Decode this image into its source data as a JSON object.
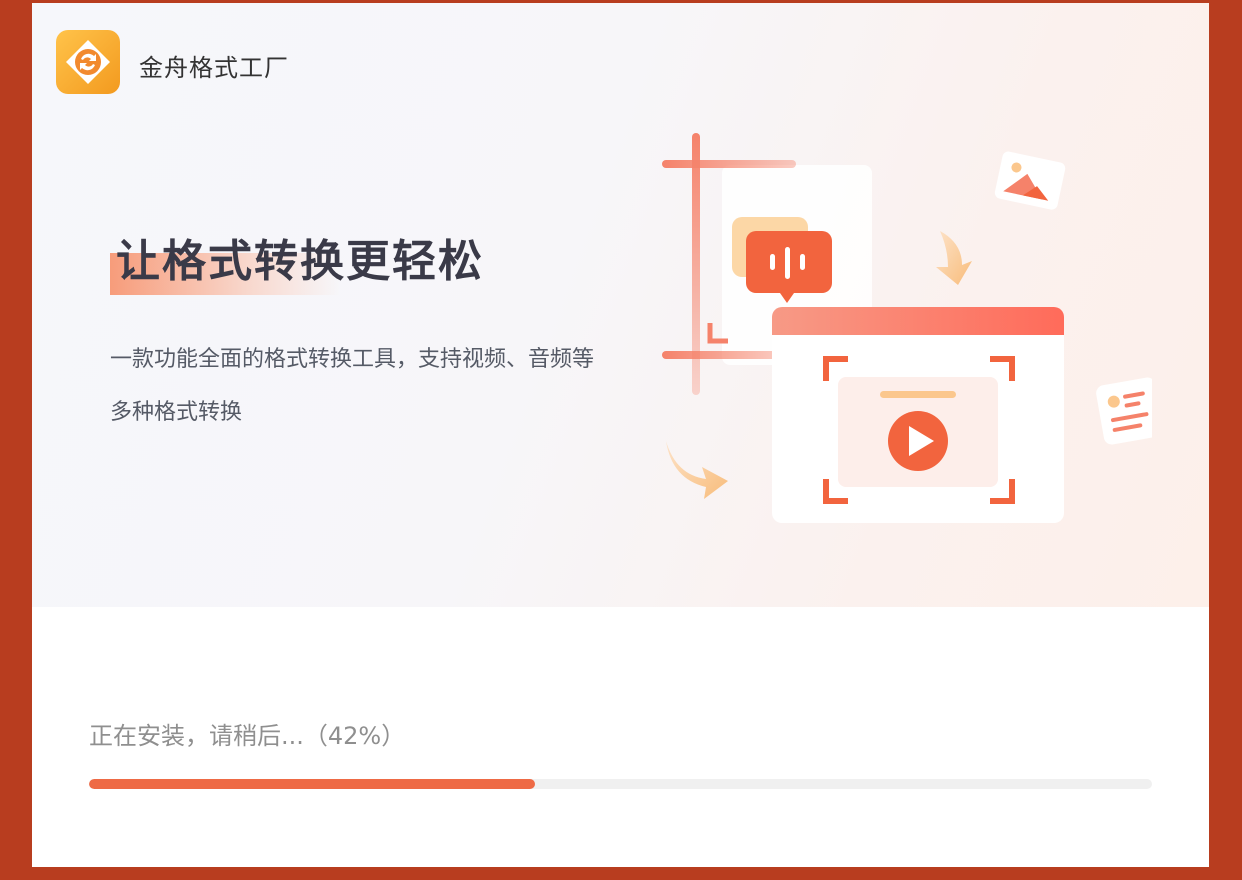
{
  "app": {
    "name": "金舟格式工厂",
    "logo_icon": "format-convert-logo-icon"
  },
  "hero": {
    "slogan": "让格式转换更轻松",
    "description": "一款功能全面的格式转换工具，支持视频、音频等多种格式转换",
    "illustration_icon": "format-conversion-illustration"
  },
  "install": {
    "status_text": "正在安装，请稍后...（42%）",
    "progress": 0.42
  },
  "colors": {
    "accent": "#ee6a45",
    "window_border": "#b83d1f",
    "track": "#f0f0f0"
  }
}
